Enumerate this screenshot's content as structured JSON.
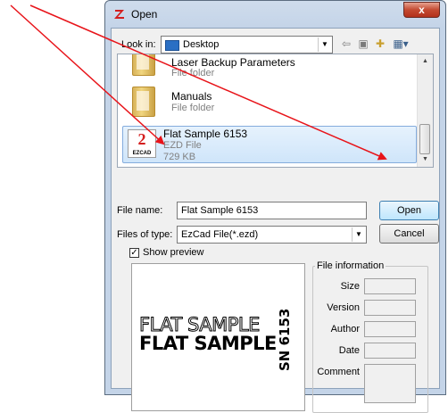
{
  "window": {
    "title": "Open",
    "close_glyph": "x",
    "app_icon": "ezcad-icon"
  },
  "toolbar": {
    "lookin_label": "Look in:",
    "lookin_value": "Desktop",
    "icons": [
      "back-icon",
      "up-folder-icon",
      "new-folder-icon",
      "views-menu-icon"
    ]
  },
  "files": [
    {
      "name": "Laser Backup Parameters",
      "type": "File folder",
      "size": ""
    },
    {
      "name": "Manuals",
      "type": "File folder",
      "size": ""
    },
    {
      "name": "Flat Sample 6153",
      "type": "EZD File",
      "size": "729 KB",
      "icon_text": "EZCAD"
    }
  ],
  "form": {
    "filename_label": "File name:",
    "filename_value": "Flat Sample 6153",
    "filetype_label": "Files of type:",
    "filetype_value": "EzCad File(*.ezd)",
    "open_label": "Open",
    "cancel_label": "Cancel"
  },
  "preview": {
    "show_label": "Show preview",
    "checked": true,
    "line1": "FLAT SAMPLE",
    "line2": "FLAT SAMPLE",
    "serial": "SN 6153"
  },
  "info": {
    "title": "File information",
    "size_label": "Size",
    "version_label": "Version",
    "author_label": "Author",
    "date_label": "Date",
    "comment_label": "Comment"
  },
  "annotation": {
    "arrow_color": "#e8141a"
  }
}
